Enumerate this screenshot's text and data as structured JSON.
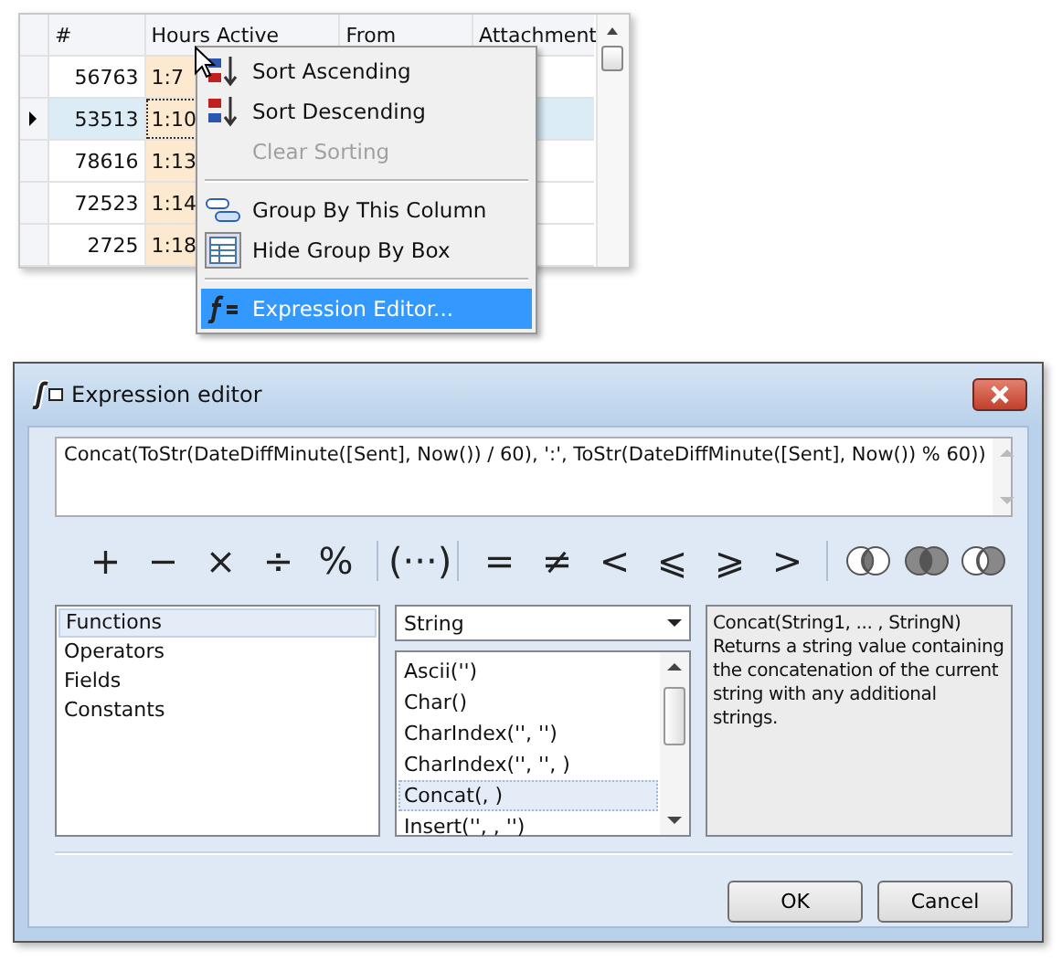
{
  "grid": {
    "columns": [
      "#",
      "Hours Active",
      "From",
      "Attachment"
    ],
    "rows": [
      {
        "number": "56763",
        "hours": "1:7",
        "selected": false
      },
      {
        "number": "53513",
        "hours": "1:10",
        "selected": true
      },
      {
        "number": "78616",
        "hours": "1:13",
        "selected": false
      },
      {
        "number": "72523",
        "hours": "1:14",
        "selected": false
      },
      {
        "number": "2725",
        "hours": "1:18",
        "selected": false
      }
    ]
  },
  "context_menu": {
    "items": [
      {
        "kind": "item",
        "label": "Sort Ascending",
        "disabled": false,
        "selected": false
      },
      {
        "kind": "item",
        "label": "Sort Descending",
        "disabled": false,
        "selected": false
      },
      {
        "kind": "item",
        "label": "Clear Sorting",
        "disabled": true,
        "selected": false
      },
      {
        "kind": "separator"
      },
      {
        "kind": "item",
        "label": "Group By This Column",
        "disabled": false,
        "selected": false
      },
      {
        "kind": "item",
        "label": "Hide Group By Box",
        "disabled": false,
        "selected": false
      },
      {
        "kind": "separator"
      },
      {
        "kind": "item",
        "label": "Expression Editor...",
        "disabled": false,
        "selected": true
      }
    ]
  },
  "dialog": {
    "title": "Expression editor",
    "expression": "Concat(ToStr(DateDiffMinute([Sent], Now()) / 60), ':', ToStr(DateDiffMinute([Sent], Now()) % 60))",
    "operators": [
      {
        "kind": "text",
        "symbol": "+"
      },
      {
        "kind": "text",
        "symbol": "−"
      },
      {
        "kind": "text",
        "symbol": "×"
      },
      {
        "kind": "text",
        "symbol": "÷"
      },
      {
        "kind": "text",
        "symbol": "%"
      },
      {
        "kind": "separator"
      },
      {
        "kind": "text",
        "symbol": "(···)"
      },
      {
        "kind": "separator"
      },
      {
        "kind": "text",
        "symbol": "="
      },
      {
        "kind": "text",
        "symbol": "≠"
      },
      {
        "kind": "text",
        "symbol": "<"
      },
      {
        "kind": "text",
        "symbol": "⩽"
      },
      {
        "kind": "text",
        "symbol": "⩾"
      },
      {
        "kind": "text",
        "symbol": ">"
      },
      {
        "kind": "separator"
      },
      {
        "kind": "circles"
      },
      {
        "kind": "circles"
      },
      {
        "kind": "circles"
      }
    ],
    "categories": [
      {
        "label": "Functions",
        "selected": true
      },
      {
        "label": "Operators",
        "selected": false
      },
      {
        "label": "Fields",
        "selected": false
      },
      {
        "label": "Constants",
        "selected": false
      }
    ],
    "function_group": "String",
    "functions": [
      {
        "label": "Ascii('')",
        "selected": false
      },
      {
        "label": "Char()",
        "selected": false
      },
      {
        "label": "CharIndex('', '')",
        "selected": false
      },
      {
        "label": "CharIndex('', '', )",
        "selected": false
      },
      {
        "label": "Concat(, )",
        "selected": true
      },
      {
        "label": "Insert('', , '')",
        "selected": false
      }
    ],
    "signature": "Concat(String1, ... , StringN)",
    "description": "Returns a string value containing the concatenation of the current string with any additional strings.",
    "buttons": [
      "OK",
      "Cancel"
    ]
  }
}
